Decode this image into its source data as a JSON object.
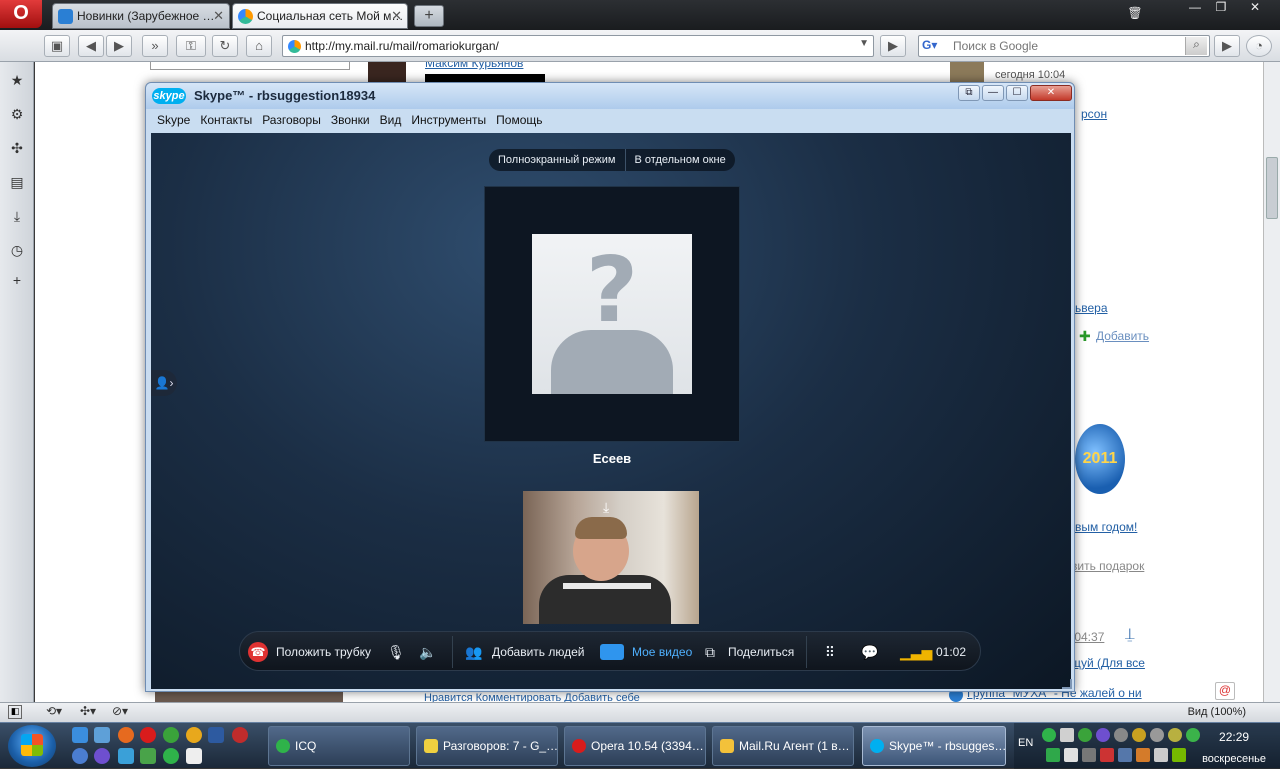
{
  "browser": {
    "opera_button": "O",
    "tabs": [
      {
        "label": "Новинки (Зарубежное …"
      },
      {
        "label": "Социальная сеть Мой м…"
      }
    ],
    "new_tab": "+",
    "url": "http://my.mail.ru/mail/romariokurgan/",
    "search_placeholder": "Поиск в Google",
    "zoom_label": "Вид (100%)"
  },
  "webpage": {
    "links": {
      "top_left_link": "Максим Курьянов",
      "right_time": "сегодня 10:04",
      "right_link_1": "рсон",
      "right_link_2": "ьвера",
      "add_link": "Добавить",
      "new_year": "вым годом!",
      "gift_link": "вить подарок",
      "date_link": "/04:37",
      "group_link_1": "щуй (Для все",
      "group_link_2": "Группа \"МУХА\" - Не жалей о ни",
      "bottom_actions": "Нравится  Комментировать  Добавить себе"
    },
    "badge_year": "2011"
  },
  "skype": {
    "title": "Skype™ - rbsuggestion18934",
    "logo": "skype",
    "menu": [
      "Skype",
      "Контакты",
      "Разговоры",
      "Звонки",
      "Вид",
      "Инструменты",
      "Помощь"
    ],
    "view_modes": {
      "fullscreen": "Полноэкранный режим",
      "separate": "В отдельном окне"
    },
    "remote_name": "Есеев",
    "callbar": {
      "hangup": "Положить трубку",
      "add_people": "Добавить людей",
      "my_video": "Мое видео",
      "share": "Поделиться",
      "timer": "01:02"
    }
  },
  "taskbar": {
    "items": [
      {
        "label": "ICQ"
      },
      {
        "label": "Разговоров: 7 - G_…"
      },
      {
        "label": "Opera 10.54 (3394…"
      },
      {
        "label": "Mail.Ru Агент (1 в…"
      },
      {
        "label": "Skype™ - rbsugges…"
      }
    ],
    "language": "EN",
    "time": "22:29",
    "day": "воскресенье"
  },
  "colors": {
    "skype_blue": "#00aff0",
    "hangup_red": "#e03232",
    "active_blue": "#4fb1ff",
    "link_blue": "#2360a5"
  }
}
